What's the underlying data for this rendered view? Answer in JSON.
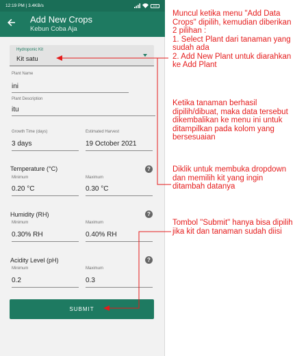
{
  "status_bar": {
    "time_info": "12:19 PM | 3.4KB/s",
    "battery": "100"
  },
  "appbar": {
    "title": "Add New Crops",
    "subtitle": "Kebun Coba Aja"
  },
  "kit_dropdown": {
    "label": "Hydroponic Kit",
    "value": "Kit satu"
  },
  "plant_name": {
    "label": "Plant Name",
    "value": "ini"
  },
  "plant_description": {
    "label": "Plant Description",
    "value": "itu"
  },
  "growth_time": {
    "label": "Growth Time (days)",
    "value": "3 days"
  },
  "estimated_harvest": {
    "label": "Estimated Harvest",
    "value": "19 October 2021"
  },
  "temperature": {
    "title": "Temperature (°C)",
    "min_label": "Minimum",
    "min_value": "0.20 °C",
    "max_label": "Maximum",
    "max_value": "0.30 °C"
  },
  "humidity": {
    "title": "Humidity (RH)",
    "min_label": "Minimum",
    "min_value": "0.30% RH",
    "max_label": "Maximum",
    "max_value": "0.40% RH"
  },
  "acidity": {
    "title": "Acidity Level (pH)",
    "min_label": "Minimum",
    "min_value": "0.2",
    "max_label": "Maximum",
    "max_value": "0.3"
  },
  "submit_label": "SUBMIT",
  "help_glyph": "?",
  "colors": {
    "primary": "#1e7a61",
    "annotation": "#e51b1b"
  },
  "icons": [
    "back-arrow-icon",
    "chevron-down-icon",
    "help-icon",
    "wifi-icon",
    "signal-icon",
    "battery-icon"
  ],
  "annotations": {
    "note1": "Muncul ketika menu \"Add Data Crops\" dipilih, kemudian diberikan 2 pilihan :\n1. Select Plant dari tanaman yang sudah ada\n2. Add New Plant untuk diarahkan ke Add Plant",
    "note2": "Ketika tanaman berhasil dipilih/dibuat, maka data tersebut dikembalikan ke menu ini untuk ditampilkan pada kolom yang bersesuaian",
    "note3": "Diklik untuk membuka dropdown dan memilih kit yang ingin ditambah datanya",
    "note4": "Tombol \"Submit\" hanya bisa dipilih jika kit dan tanaman sudah diisi"
  }
}
